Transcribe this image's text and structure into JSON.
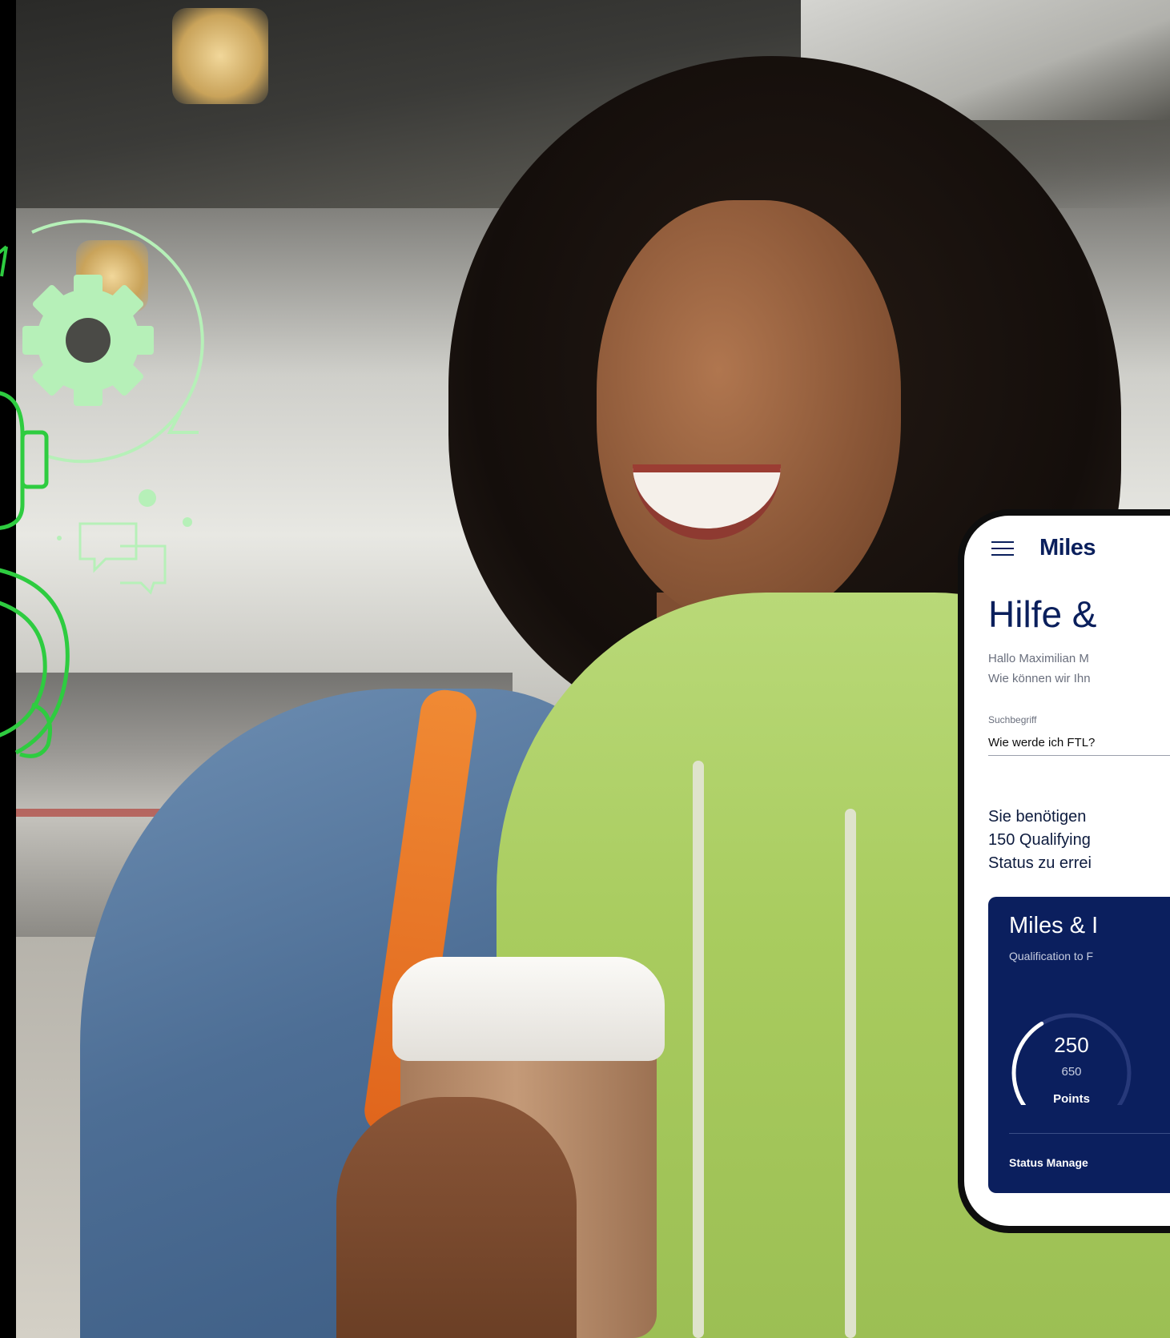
{
  "app": {
    "brand": "Miles",
    "page_title": "Hilfe &",
    "greeting_line1": "Hallo Maximilian M",
    "greeting_line2": "Wie können wir Ihn",
    "search": {
      "label": "Suchbegriff",
      "value": "Wie werde ich FTL?"
    },
    "answer_lines": [
      "Sie benötigen",
      "150 Qualifying",
      "Status zu errei"
    ],
    "status_card": {
      "title": "Miles & I",
      "subtitle": "Qualification to F",
      "points_value": "250",
      "points_total": "650",
      "points_label": "Points",
      "progress_fraction": 0.3846,
      "link_label": "Status Manage"
    }
  },
  "colors": {
    "brand_navy": "#0a1f5c",
    "card_navy": "#0b1f5e",
    "illustration_green": "#2ecc40",
    "illustration_mint": "#b6f0b8"
  },
  "icons": [
    "menu-icon",
    "gear-icon",
    "sync-arrows-icon",
    "chat-bubbles-icon",
    "headset-icon"
  ]
}
